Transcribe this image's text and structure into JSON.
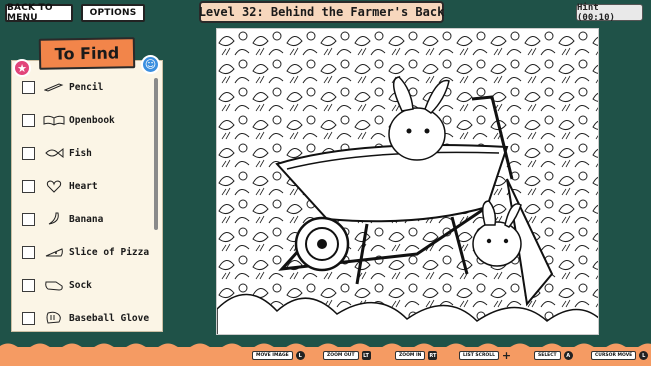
{
  "top_bar": {
    "back_label": "BACK TO MENU",
    "options_label": "OPTIONS",
    "level_title": "Level 32: Behind the Farmer's Back",
    "hint_label": "Hint (00:10)"
  },
  "find_panel": {
    "title": "To Find",
    "items": [
      {
        "label": "Pencil",
        "icon": "pencil-icon"
      },
      {
        "label": "Openbook",
        "icon": "open-book-icon"
      },
      {
        "label": "Fish",
        "icon": "fish-icon"
      },
      {
        "label": "Heart",
        "icon": "heart-icon"
      },
      {
        "label": "Banana",
        "icon": "banana-icon"
      },
      {
        "label": "Slice of Pizza",
        "icon": "pizza-slice-icon"
      },
      {
        "label": "Sock",
        "icon": "sock-icon"
      },
      {
        "label": "Baseball Glove",
        "icon": "baseball-glove-icon"
      }
    ]
  },
  "controls": [
    {
      "label": "MOVE IMAGE",
      "key": "L"
    },
    {
      "label": "ZOOM OUT",
      "key": "LT"
    },
    {
      "label": "ZOOM IN",
      "key": "RT"
    },
    {
      "label": "LIST SCROLL",
      "key": "+"
    },
    {
      "label": "SELECT",
      "key": "A"
    },
    {
      "label": "CURSOR MOVE",
      "key": "L"
    }
  ],
  "colors": {
    "background": "#1f5248",
    "accent": "#f2854a",
    "title_bg": "#f7d7bd",
    "panel": "#fbf5e6"
  }
}
